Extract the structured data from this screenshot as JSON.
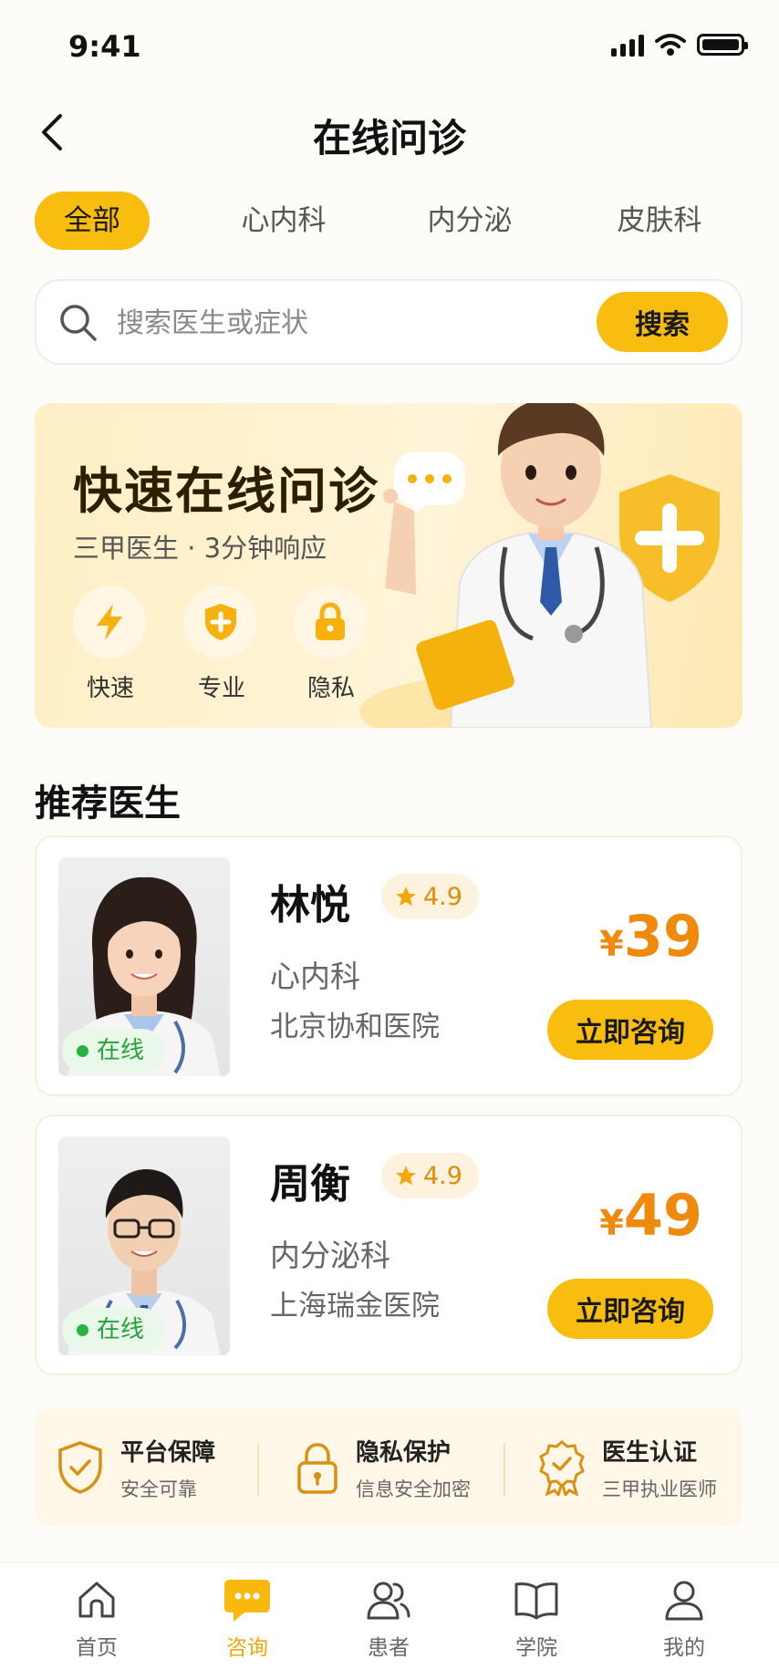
{
  "status_bar": {
    "time": "9:41"
  },
  "header": {
    "title": "在线问诊"
  },
  "tabs": [
    {
      "label": "全部",
      "active": true
    },
    {
      "label": "心内科",
      "active": false
    },
    {
      "label": "内分泌",
      "active": false
    },
    {
      "label": "皮肤科",
      "active": false
    }
  ],
  "search": {
    "placeholder": "搜索医生或症状",
    "button_label": "搜索"
  },
  "banner": {
    "title": "快速在线问诊",
    "subtitle": "三甲医生 · 3分钟响应",
    "features": [
      {
        "icon": "lightning-icon",
        "label": "快速"
      },
      {
        "icon": "shield-plus-icon",
        "label": "专业"
      },
      {
        "icon": "lock-icon",
        "label": "隐私"
      }
    ]
  },
  "recommended": {
    "title": "推荐医生",
    "doctors": [
      {
        "name": "林悦",
        "rating": "4.9",
        "department": "心内科",
        "hospital": "北京协和医院",
        "price_symbol": "¥",
        "price": "39",
        "status": "在线",
        "button_label": "立即咨询"
      },
      {
        "name": "周衡",
        "rating": "4.9",
        "department": "内分泌科",
        "hospital": "上海瑞金医院",
        "price_symbol": "¥",
        "price": "49",
        "status": "在线",
        "button_label": "立即咨询"
      }
    ]
  },
  "guarantees": [
    {
      "icon": "shield-check-icon",
      "title": "平台保障",
      "subtitle": "安全可靠"
    },
    {
      "icon": "lock-icon",
      "title": "隐私保护",
      "subtitle": "信息安全加密"
    },
    {
      "icon": "badge-check-icon",
      "title": "医生认证",
      "subtitle": "三甲执业医师"
    }
  ],
  "tab_bar": {
    "items": [
      {
        "icon": "home-icon",
        "label": "首页",
        "active": false
      },
      {
        "icon": "chat-icon",
        "label": "咨询",
        "active": true
      },
      {
        "icon": "patients-icon",
        "label": "患者",
        "active": false
      },
      {
        "icon": "book-icon",
        "label": "学院",
        "active": false
      },
      {
        "icon": "user-icon",
        "label": "我的",
        "active": false
      }
    ]
  },
  "colors": {
    "accent": "#f9bd0f",
    "price": "#f08a0c",
    "online": "#26b43f"
  }
}
